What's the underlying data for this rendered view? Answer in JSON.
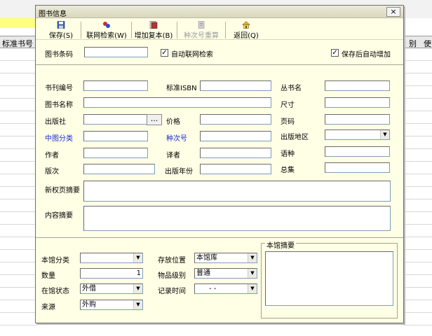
{
  "background": {
    "columns": [
      "标准书号",
      "别",
      "使"
    ]
  },
  "dialog": {
    "title": "图书信息",
    "close_glyph": "×",
    "toolbar": {
      "save": "保存(S)",
      "online_search": "联网检索(W)",
      "add_copy": "增加复本(B)",
      "recalc_call_no": "种次号重算",
      "back": "返回(Q)"
    },
    "barcode": {
      "label": "图书条码",
      "value": ""
    },
    "auto_online_search": {
      "label": "自动联网检索",
      "checked": true
    },
    "auto_increment_after_save": {
      "label": "保存后自动增加",
      "checked": true
    },
    "fields": {
      "journal_no": "书刊编号",
      "isbn": "标准ISBN",
      "series_title": "丛书名",
      "book_title": "图书名称",
      "size": "尺寸",
      "publisher": "出版社",
      "publisher_button": "...",
      "price": "价格",
      "pages": "页码",
      "clc_class": "中图分类",
      "seq_no": "种次号",
      "pub_place": "出版地区",
      "author": "作者",
      "translator": "译者",
      "language": "语种",
      "edition": "版次",
      "pub_year": "出版年份",
      "collection": "总集",
      "copyright_abstract": "新权页摘要",
      "content_abstract": "内容摘要"
    },
    "bottom": {
      "library_class_label": "本馆分类",
      "library_class_value": "",
      "quantity_label": "数量",
      "quantity_value": "1",
      "status_label": "在馆状态",
      "status_value": "外借",
      "source_label": "来源",
      "source_value": "外购",
      "location_label": "存放位置",
      "location_value": "本馆库",
      "level_label": "物品级别",
      "level_value": "普通",
      "record_time_label": "记录时间",
      "record_time_value": "-   -",
      "library_abstract_label": "本馆摘要"
    }
  },
  "colors": {
    "dialog_bg": "#ffffe6",
    "link_blue": "#1a2bd1",
    "grid_yellow": "#ffff80"
  },
  "icons": [
    "save-icon",
    "online-search-icon",
    "add-copy-icon",
    "recalc-icon",
    "back-home-icon",
    "close-icon",
    "dropdown-arrow-icon",
    "checkbox-check-icon"
  ]
}
